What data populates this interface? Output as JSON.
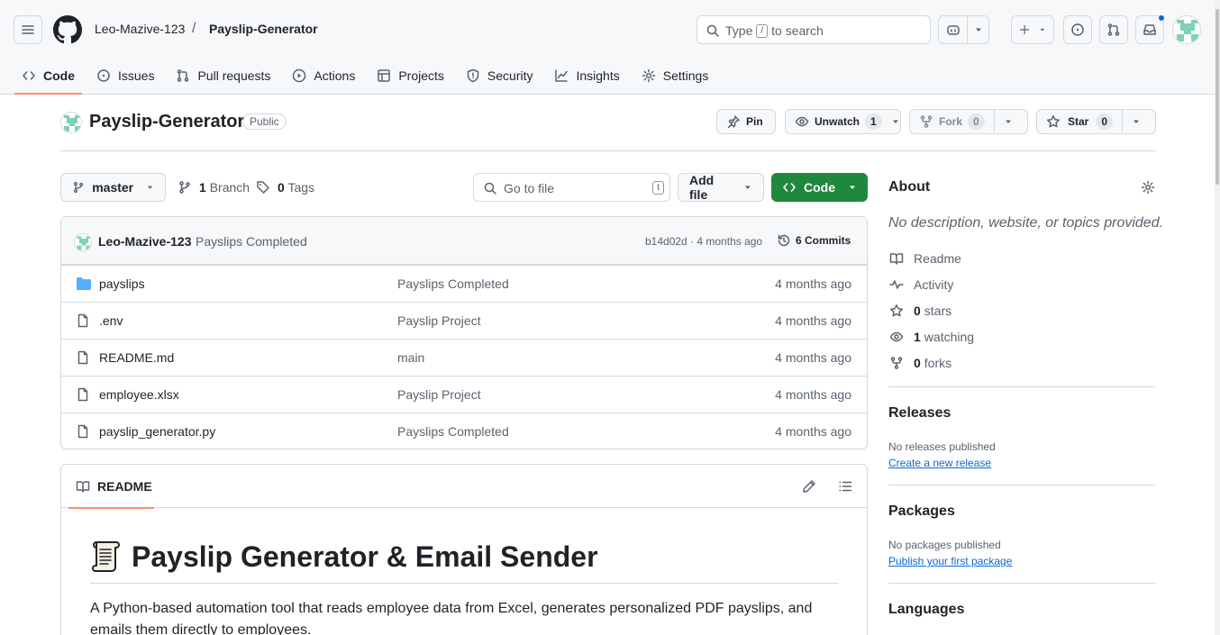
{
  "header": {
    "owner": "Leo-Mazive-123",
    "separator": "/",
    "repo": "Payslip-Generator",
    "search": {
      "prefix": "Type",
      "key": "/",
      "suffix": "to search"
    }
  },
  "nav": {
    "tabs": [
      {
        "label": "Code",
        "icon": "code-icon",
        "active": true
      },
      {
        "label": "Issues",
        "icon": "issue-icon"
      },
      {
        "label": "Pull requests",
        "icon": "pull-request-icon"
      },
      {
        "label": "Actions",
        "icon": "play-icon"
      },
      {
        "label": "Projects",
        "icon": "table-icon"
      },
      {
        "label": "Security",
        "icon": "shield-icon"
      },
      {
        "label": "Insights",
        "icon": "graph-icon"
      },
      {
        "label": "Settings",
        "icon": "gear-icon"
      }
    ]
  },
  "repo": {
    "name": "Payslip-Generator",
    "visibility": "Public",
    "pin_label": "Pin",
    "unwatch_label": "Unwatch",
    "watch_count": "1",
    "fork_label": "Fork",
    "fork_count": "0",
    "star_label": "Star",
    "star_count": "0"
  },
  "browser": {
    "branch": "master",
    "branch_count": "1",
    "branch_label": "Branch",
    "tag_count": "0",
    "tag_label": "Tags",
    "goto_placeholder": "Go to file",
    "goto_key": "t",
    "add_file_label": "Add file",
    "code_label": "Code"
  },
  "commit": {
    "author": "Leo-Mazive-123",
    "message": "Payslips Completed",
    "meta": "b14d02d · 4 months ago",
    "count_label": "6 Commits"
  },
  "files": [
    {
      "name": "payslips",
      "type": "folder",
      "message": "Payslips Completed",
      "age": "4 months ago"
    },
    {
      "name": ".env",
      "type": "file",
      "message": "Payslip Project",
      "age": "4 months ago"
    },
    {
      "name": "README.md",
      "type": "file",
      "message": "main",
      "age": "4 months ago"
    },
    {
      "name": "employee.xlsx",
      "type": "file",
      "message": "Payslip Project",
      "age": "4 months ago"
    },
    {
      "name": "payslip_generator.py",
      "type": "file",
      "message": "Payslips Completed",
      "age": "4 months ago"
    }
  ],
  "readme": {
    "tab_label": "README",
    "heading": "Payslip Generator & Email Sender",
    "heading_emoji": "scroll-icon",
    "paragraph": "A Python-based automation tool that reads employee data from Excel, generates personalized PDF payslips, and emails them directly to employees."
  },
  "about": {
    "title": "About",
    "description": "No description, website, or topics provided.",
    "readme_label": "Readme",
    "activity_label": "Activity",
    "stars_count": "0",
    "stars_label": "stars",
    "watching_count": "1",
    "watching_label": "watching",
    "forks_count": "0",
    "forks_label": "forks"
  },
  "releases": {
    "title": "Releases",
    "empty_text": "No releases published",
    "link": "Create a new release"
  },
  "packages": {
    "title": "Packages",
    "empty_text": "No packages published",
    "link": "Publish your first package"
  },
  "languages": {
    "title": "Languages"
  },
  "colors": {
    "accent_green": "#1f883d",
    "tab_underline": "#fd8c73",
    "link_blue": "#0969da",
    "folder_blue": "#54aeff",
    "notification_dot": "#0969da"
  }
}
